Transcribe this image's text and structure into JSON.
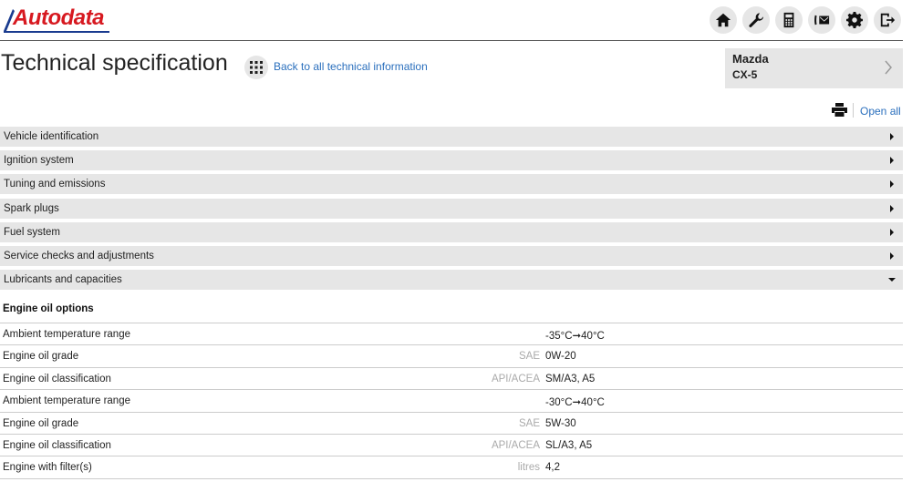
{
  "header": {
    "logo_text": "Autodata",
    "brand_color": "#d71920",
    "accent_color": "#2a6fbd",
    "nav_icons": [
      "home-icon",
      "wrench-icon",
      "calculator-icon",
      "contact-icon",
      "gear-icon",
      "logout-icon"
    ]
  },
  "page": {
    "title": "Technical specification",
    "back_link": "Back to all technical information",
    "open_all": "Open all"
  },
  "vehicle": {
    "make": "Mazda",
    "model": "CX-5"
  },
  "sections": [
    {
      "label": "Vehicle identification",
      "expanded": false
    },
    {
      "label": "Ignition system",
      "expanded": false
    },
    {
      "label": "Tuning and emissions",
      "expanded": false
    },
    {
      "label": "Spark plugs",
      "expanded": false
    },
    {
      "label": "Fuel system",
      "expanded": false
    },
    {
      "label": "Service checks and adjustments",
      "expanded": false
    },
    {
      "label": "Lubricants and capacities",
      "expanded": true
    }
  ],
  "lubricants": {
    "subheading": "Engine oil options",
    "rows": [
      {
        "label": "Ambient temperature range",
        "unit": "",
        "value": "-35°C➞40°C"
      },
      {
        "label": "Engine oil grade",
        "unit": "SAE",
        "value": "0W-20"
      },
      {
        "label": "Engine oil classification",
        "unit": "API/ACEA",
        "value": "SM/A3, A5"
      },
      {
        "label": "Ambient temperature range",
        "unit": "",
        "value": "-30°C➞40°C"
      },
      {
        "label": "Engine oil grade",
        "unit": "SAE",
        "value": "5W-30"
      },
      {
        "label": "Engine oil classification",
        "unit": "API/ACEA",
        "value": "SL/A3, A5"
      },
      {
        "label": "Engine with filter(s)",
        "unit": "litres",
        "value": "4,2"
      }
    ]
  }
}
